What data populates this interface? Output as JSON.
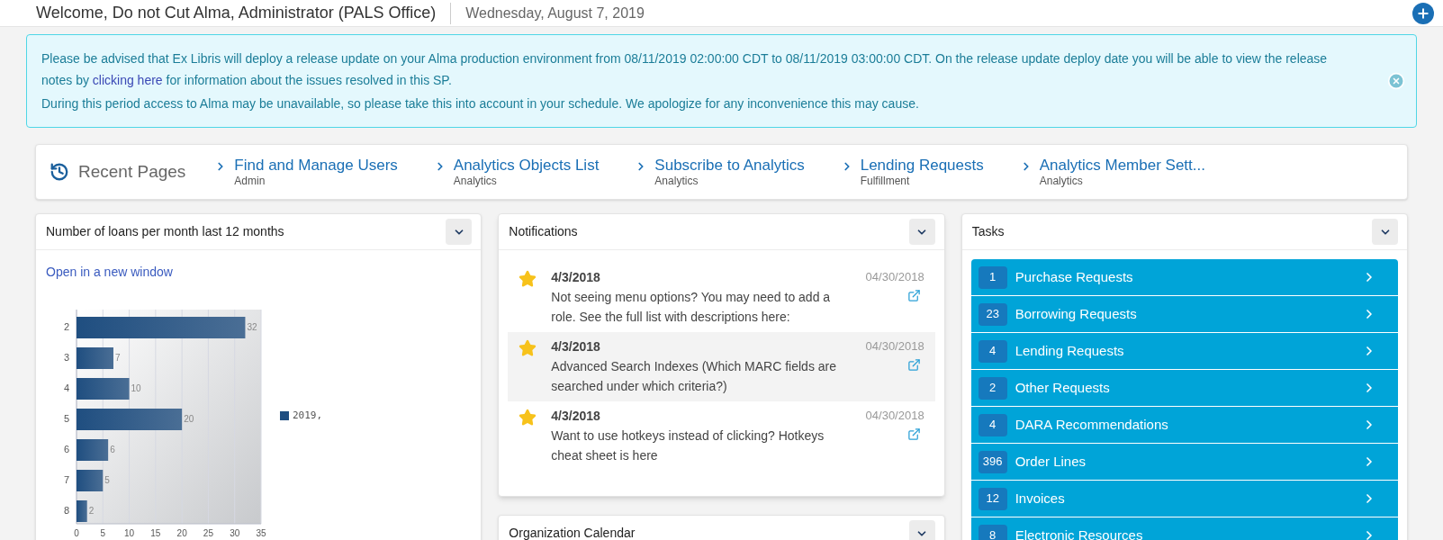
{
  "header": {
    "welcome": "Welcome, Do not Cut Alma, Administrator (PALS Office)",
    "date": "Wednesday, August 7, 2019"
  },
  "banner": {
    "line1_before": "Please be advised that Ex Libris will deploy a release update on your Alma production environment from 08/11/2019 02:00:00 CDT to 08/11/2019 03:00:00 CDT. On the release update deploy date you will be able to view the release notes by",
    "link": "clicking here",
    "line1_after": "for information about the issues resolved in this SP.",
    "line2": "During this period access to Alma may be unavailable, so please take this into account in your schedule. We apologize for any inconvenience this may cause."
  },
  "recent_pages": {
    "title": "Recent Pages",
    "items": [
      {
        "label": "Find and Manage Users",
        "area": "Admin"
      },
      {
        "label": "Analytics Objects List",
        "area": "Analytics"
      },
      {
        "label": "Subscribe to Analytics",
        "area": "Analytics"
      },
      {
        "label": "Lending Requests",
        "area": "Fulfillment"
      },
      {
        "label": "Analytics Member Sett...",
        "area": "Analytics"
      }
    ]
  },
  "loans_widget": {
    "title": "Number of loans per month last 12 months",
    "link": "Open in a new window",
    "chart_data": {
      "type": "bar",
      "orientation": "horizontal",
      "categories": [
        "2",
        "3",
        "4",
        "5",
        "6",
        "7",
        "8"
      ],
      "series": [
        {
          "name": "2019,",
          "color": "#1f4e80",
          "values": [
            32,
            7,
            10,
            20,
            6,
            5,
            2
          ]
        }
      ],
      "xlim": [
        0,
        35
      ],
      "xticks": [
        0,
        5,
        10,
        15,
        20,
        25,
        30,
        35
      ],
      "data_labels": true,
      "grid": true
    }
  },
  "notifications": {
    "title": "Notifications",
    "items": [
      {
        "date": "4/3/2018",
        "text": "Not seeing menu options? You may need to add a role. See the full list with descriptions here:",
        "posted": "04/30/2018",
        "selected": false
      },
      {
        "date": "4/3/2018",
        "text": "Advanced Search Indexes (Which MARC fields are searched under which criteria?)",
        "posted": "04/30/2018",
        "selected": true
      },
      {
        "date": "4/3/2018",
        "text": "Want to use hotkeys instead of clicking? Hotkeys cheat sheet is here",
        "posted": "04/30/2018",
        "selected": false
      }
    ]
  },
  "calendar": {
    "title": "Organization Calendar"
  },
  "tasks": {
    "title": "Tasks",
    "items": [
      {
        "count": "1",
        "label": "Purchase Requests"
      },
      {
        "count": "23",
        "label": "Borrowing Requests"
      },
      {
        "count": "4",
        "label": "Lending Requests"
      },
      {
        "count": "2",
        "label": "Other Requests"
      },
      {
        "count": "4",
        "label": "DARA Recommendations"
      },
      {
        "count": "396",
        "label": "Order Lines"
      },
      {
        "count": "12",
        "label": "Invoices"
      },
      {
        "count": "8",
        "label": "Electronic Resources"
      }
    ]
  }
}
